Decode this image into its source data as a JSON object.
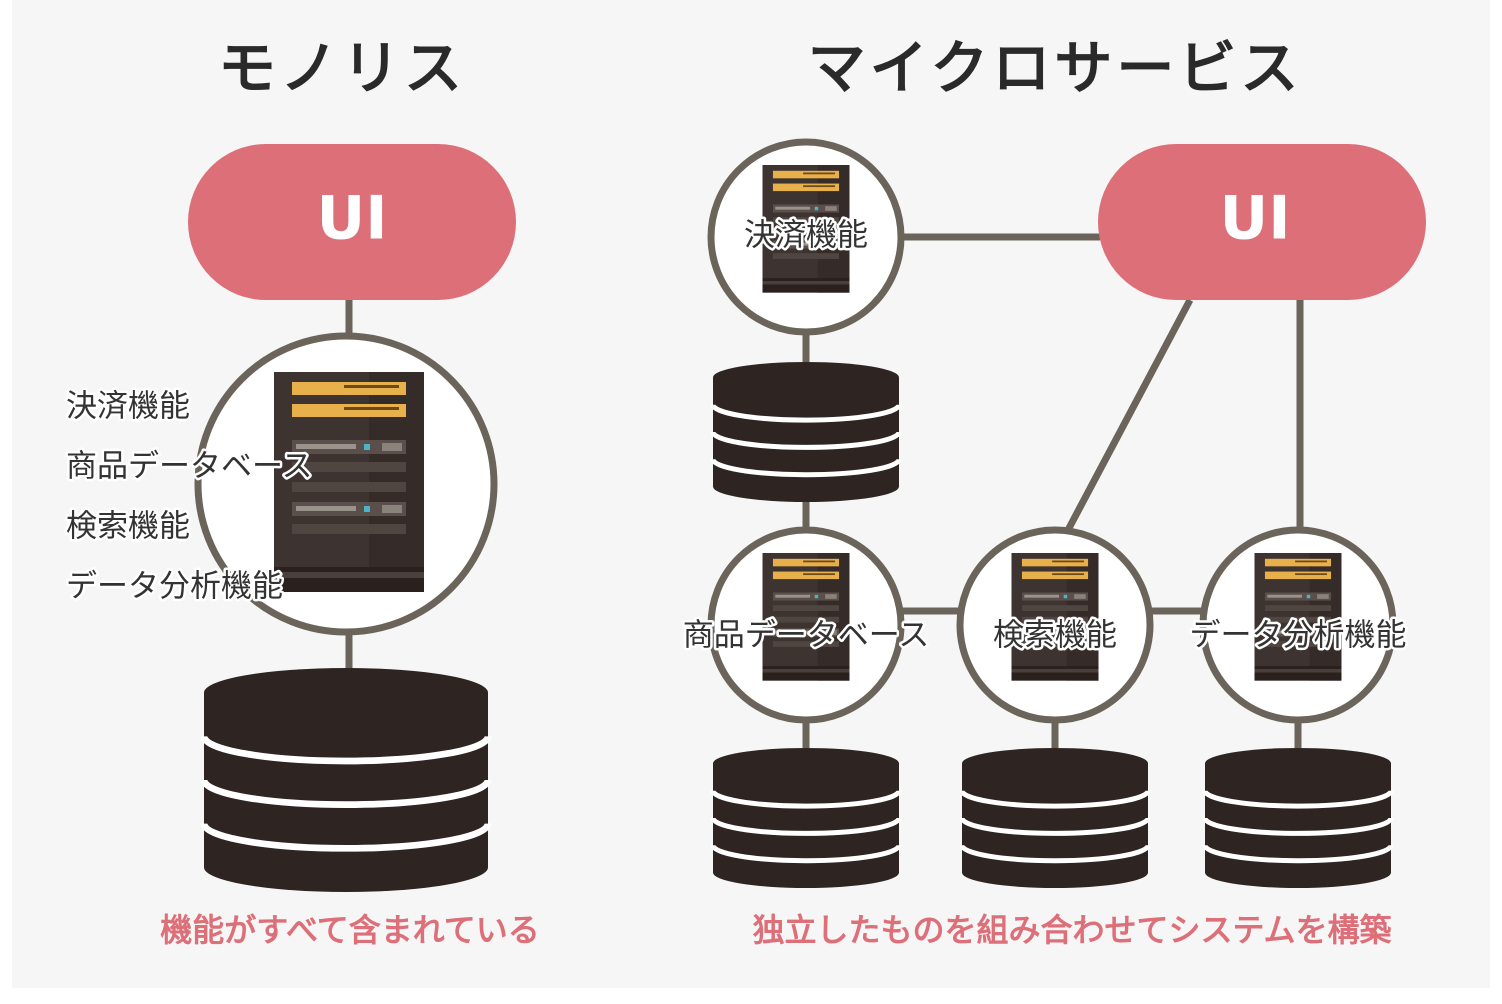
{
  "colors": {
    "background": "#f6f6f6",
    "ui_pill": "#dd6f79",
    "ring": "#6b645b",
    "server_body": "#3d3330",
    "server_stripe": "#e8b04a",
    "database": "#2e2523",
    "caption": "#dd6f79"
  },
  "monolith": {
    "title": "モノリス",
    "ui_label": "UI",
    "features": [
      "決済機能",
      "商品データベース",
      "検索機能",
      "データ分析機能"
    ],
    "caption": "機能がすべて含まれている"
  },
  "microservices": {
    "title": "マイクロサービス",
    "ui_label": "UI",
    "services": [
      {
        "label": "決済機能"
      },
      {
        "label": "商品データベース"
      },
      {
        "label": "検索機能"
      },
      {
        "label": "データ分析機能"
      }
    ],
    "caption": "独立したものを組み合わせてシステムを構築"
  },
  "icons": {
    "server": "server-rack-icon",
    "database": "database-stack-icon"
  }
}
